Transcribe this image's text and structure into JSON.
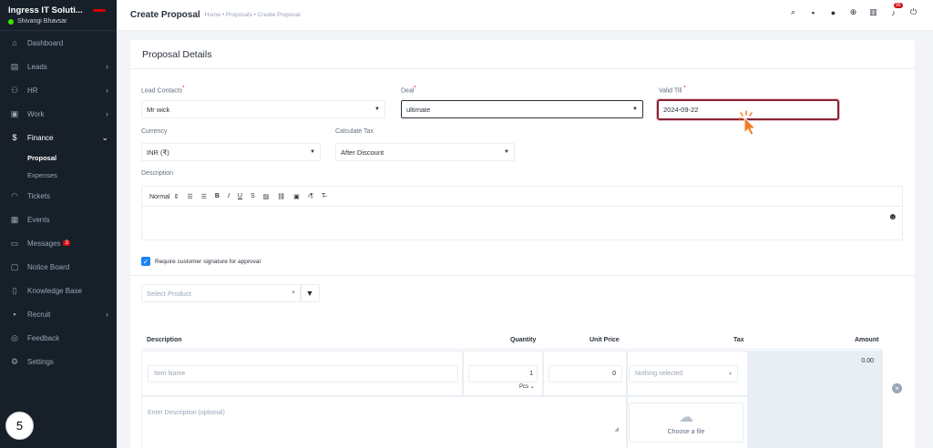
{
  "sidebar": {
    "company": "Ingress IT Soluti...",
    "user": "Shivangi Bhavsar",
    "items": [
      {
        "label": "Dashboard",
        "icon": "home-icon"
      },
      {
        "label": "Leads",
        "icon": "leads-icon"
      },
      {
        "label": "HR",
        "icon": "people-icon"
      },
      {
        "label": "Work",
        "icon": "briefcase-icon"
      },
      {
        "label": "Finance",
        "icon": "dollar-icon"
      },
      {
        "label": "Tickets",
        "icon": "headset-icon"
      },
      {
        "label": "Events",
        "icon": "calendar-icon"
      },
      {
        "label": "Messages",
        "icon": "chat-icon",
        "badge": "3"
      },
      {
        "label": "Notice Board",
        "icon": "notice-icon"
      },
      {
        "label": "Knowledge Base",
        "icon": "book-icon"
      },
      {
        "label": "Recruit",
        "icon": "recruit-icon"
      },
      {
        "label": "Feedback",
        "icon": "feedback-icon"
      },
      {
        "label": "Settings",
        "icon": "gear-icon"
      }
    ],
    "finance_sub": [
      "Proposal",
      "Expenses"
    ],
    "step": "5"
  },
  "header": {
    "title": "Create Proposal",
    "breadcrumb": "Home • Proposals • Create Proposal",
    "notif_count": "96"
  },
  "form": {
    "section_title": "Proposal Details",
    "lead_contacts_label": "Lead Contacts",
    "lead_contacts_value": "Mr wick",
    "deal_label": "Deal",
    "deal_value": "ultimate",
    "valid_till_label": "Valid Till",
    "valid_till_value": "2024-09-22",
    "currency_label": "Currency",
    "currency_value": "INR (₹)",
    "calculate_tax_label": "Calculate Tax",
    "calculate_tax_value": "After Discount",
    "description_label": "Description",
    "editor_format": "Normal",
    "signature_label": "Require customer signature for approval",
    "select_product_placeholder": "Select Product"
  },
  "items_table": {
    "headers": [
      "Description",
      "Quantity",
      "Unit Price",
      "Tax",
      "Amount"
    ],
    "item_name_placeholder": "Item Name",
    "quantity": "1",
    "unit": "Pcs",
    "unit_price": "0",
    "tax_placeholder": "Nothing selected",
    "amount": "0.00",
    "description_placeholder": "Enter Description (optional)",
    "upload_label": "Choose a file"
  },
  "colors": {
    "sidebar_bg": "#171f29",
    "accent": "#1d82f5",
    "focus_border": "#8a2436",
    "badge": "#d21010",
    "cursor": "#f07c22"
  }
}
